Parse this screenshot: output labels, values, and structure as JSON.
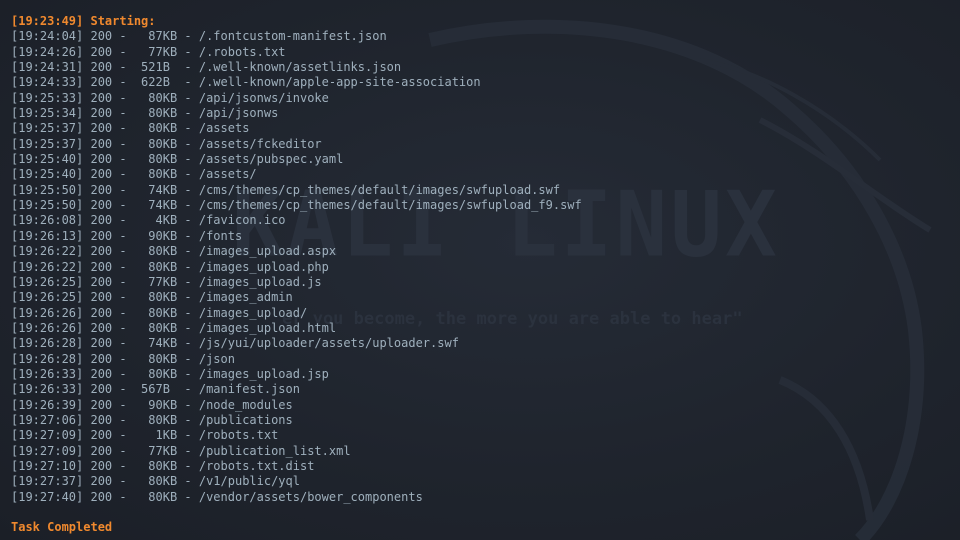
{
  "wallpaper": {
    "logo_text": "KALI LINUX",
    "tagline": "er you become, the more you are able to hear\""
  },
  "terminal": {
    "start_line": "[19:23:49] Starting: ",
    "lines": [
      "[19:24:04] 200 -   87KB - /.fontcustom-manifest.json",
      "[19:24:26] 200 -   77KB - /.robots.txt",
      "[19:24:31] 200 -  521B  - /.well-known/assetlinks.json",
      "[19:24:33] 200 -  622B  - /.well-known/apple-app-site-association",
      "[19:25:33] 200 -   80KB - /api/jsonws/invoke",
      "[19:25:34] 200 -   80KB - /api/jsonws",
      "[19:25:37] 200 -   80KB - /assets",
      "[19:25:37] 200 -   80KB - /assets/fckeditor",
      "[19:25:40] 200 -   80KB - /assets/pubspec.yaml",
      "[19:25:40] 200 -   80KB - /assets/",
      "[19:25:50] 200 -   74KB - /cms/themes/cp_themes/default/images/swfupload.swf",
      "[19:25:50] 200 -   74KB - /cms/themes/cp_themes/default/images/swfupload_f9.swf",
      "[19:26:08] 200 -    4KB - /favicon.ico",
      "[19:26:13] 200 -   90KB - /fonts",
      "[19:26:22] 200 -   80KB - /images_upload.aspx",
      "[19:26:22] 200 -   80KB - /images_upload.php",
      "[19:26:25] 200 -   77KB - /images_upload.js",
      "[19:26:25] 200 -   80KB - /images_admin",
      "[19:26:26] 200 -   80KB - /images_upload/",
      "[19:26:26] 200 -   80KB - /images_upload.html",
      "[19:26:28] 200 -   74KB - /js/yui/uploader/assets/uploader.swf",
      "[19:26:28] 200 -   80KB - /json",
      "[19:26:33] 200 -   80KB - /images_upload.jsp",
      "[19:26:33] 200 -  567B  - /manifest.json",
      "[19:26:39] 200 -   90KB - /node_modules",
      "[19:27:06] 200 -   80KB - /publications",
      "[19:27:09] 200 -    1KB - /robots.txt",
      "[19:27:09] 200 -   77KB - /publication_list.xml",
      "[19:27:10] 200 -   80KB - /robots.txt.dist",
      "[19:27:37] 200 -   80KB - /v1/public/yql",
      "[19:27:40] 200 -   80KB - /vendor/assets/bower_components"
    ],
    "done_line": "Task Completed"
  },
  "colors": {
    "background": "#1f232c",
    "text": "#9fb0bd",
    "accent": "#f0892e"
  }
}
